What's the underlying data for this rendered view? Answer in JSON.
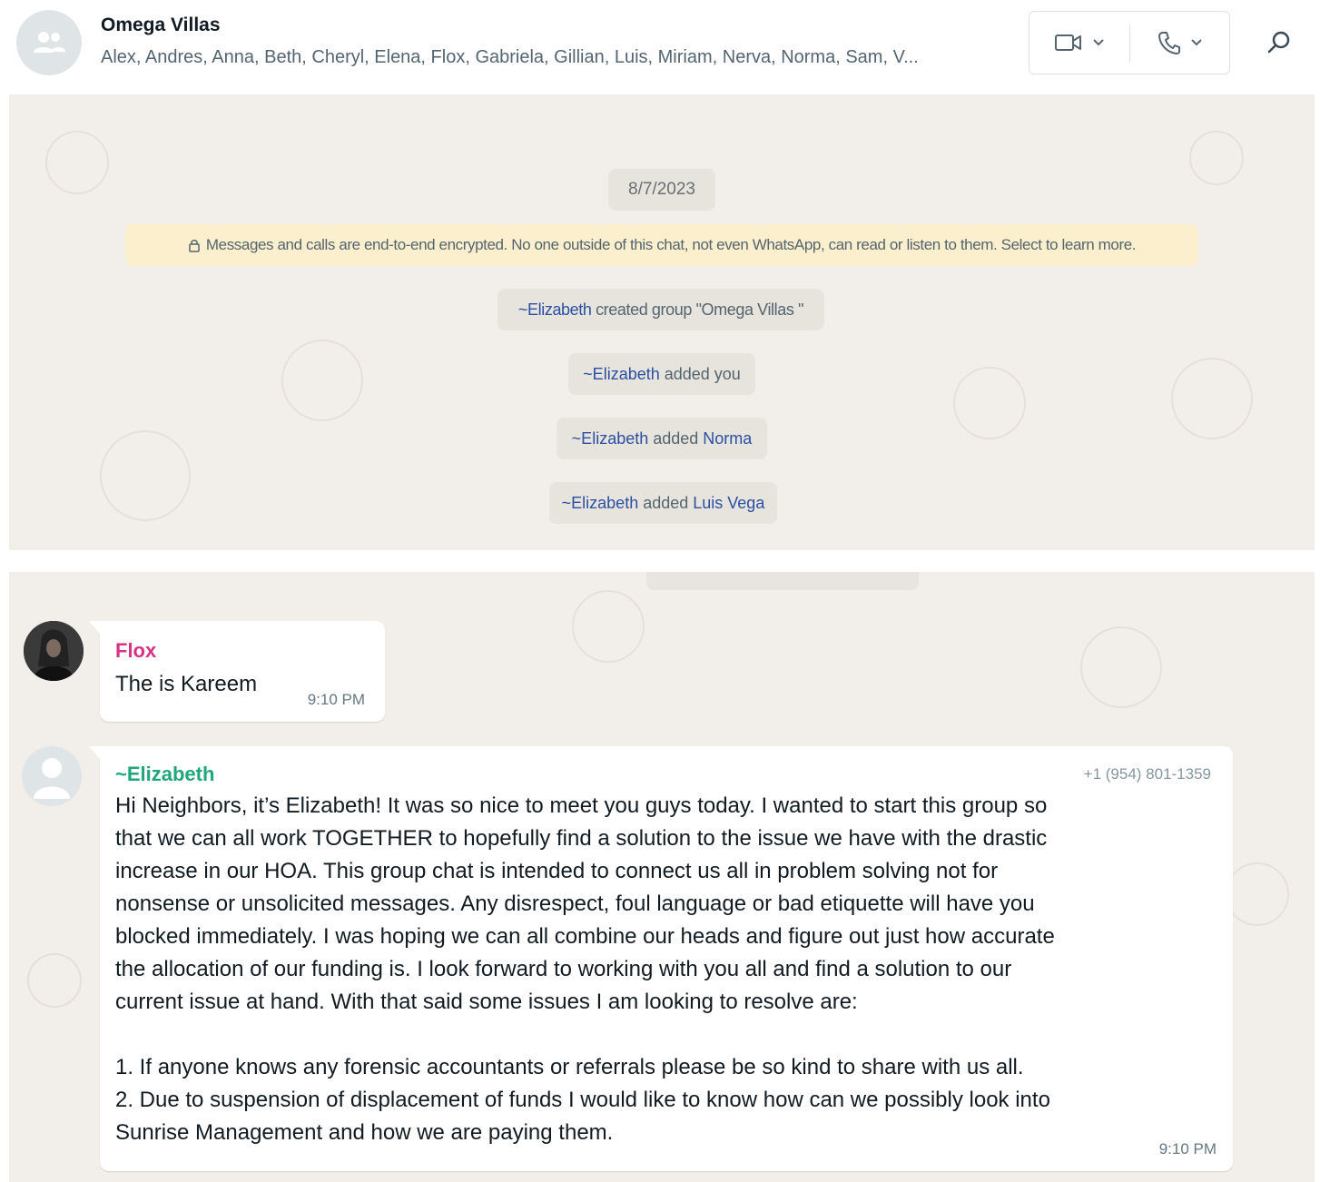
{
  "header": {
    "group_name": "Omega Villas",
    "members": "Alex, Andres, Anna, Beth, Cheryl, Elena, Flox, Gabriela, Gillian, Luis, Miriam, Nerva, Norma, Sam, V...",
    "icons": [
      "group-avatar-icon",
      "video-call-icon",
      "chevron-down-icon",
      "voice-call-icon",
      "chevron-down-icon",
      "search-icon"
    ]
  },
  "top": {
    "date": "8/7/2023",
    "encryption_notice": "Messages and calls are end-to-end encrypted. No one outside of this chat, not even WhatsApp, can read or listen to them. Select to learn more.",
    "system_messages": [
      {
        "actor": "~Elizabeth",
        "action": " created group \"Omega Villas \"",
        "target": ""
      },
      {
        "actor": "~Elizabeth",
        "action": " added you",
        "target": ""
      },
      {
        "actor": "~Elizabeth",
        "action": " added ",
        "target": "Norma"
      },
      {
        "actor": "~Elizabeth",
        "action": " added ",
        "target": "Luis Vega"
      }
    ]
  },
  "messages": {
    "flox": {
      "sender": "Flox",
      "text": "The is Kareem",
      "time": "9:10 PM"
    },
    "elizabeth": {
      "sender": "~Elizabeth",
      "phone": "+1 (954) 801-1359",
      "lines": [
        "Hi Neighbors, it’s Elizabeth! It was so nice to meet you guys today. I wanted to start this group so",
        "that we can all work TOGETHER to hopefully find a solution to the issue we have with the drastic",
        "increase in our HOA. This group chat is intended to connect us all in problem solving not for",
        "nonsense or unsolicited messages. Any disrespect, foul language or bad etiquette will have you",
        "blocked immediately. I was hoping we can all combine our heads and figure out just how accurate",
        "the allocation of our funding is. I look forward to working with you all and find a solution to our",
        "current issue at hand. With that said some issues I am looking to resolve are:",
        "",
        "1. If anyone knows any forensic accountants or referrals please be so kind to share with us all.",
        "2. Due to suspension of displacement of funds I would like to know how can we possibly look into",
        "Sunrise Management and how we are paying them."
      ],
      "time": "9:10 PM"
    }
  },
  "colors": {
    "wallpaper": "#f2eee9",
    "encryption_banner": "#fcefcd",
    "flox_name": "#d63384",
    "elizabeth_name": "#1fa67a",
    "mention_blue": "#2a4fa3"
  }
}
